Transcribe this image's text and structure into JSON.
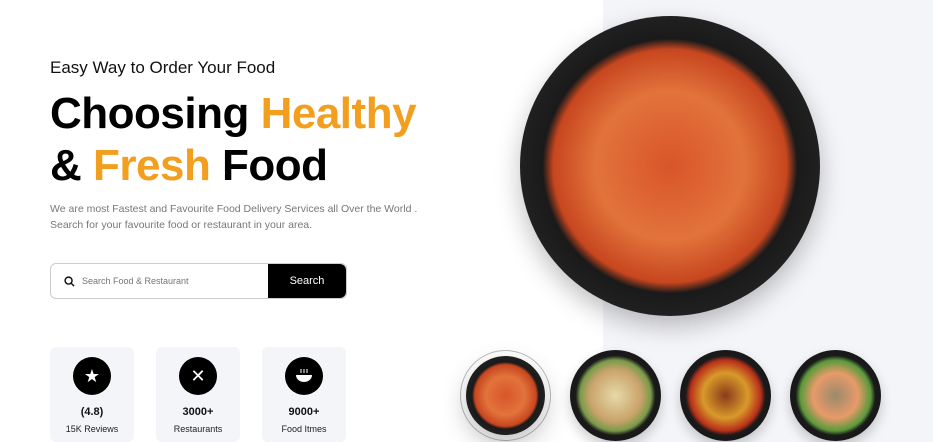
{
  "hero": {
    "eyebrow": "Easy Way to Order Your Food",
    "title_part1": "Choosing ",
    "title_accent1": "Healthy",
    "title_part2": "& ",
    "title_accent2": "Fresh",
    "title_part3": " Food",
    "description_line1": "We are most Fastest and Favourite Food Delivery Services all Over the World .",
    "description_line2": "Search for your favourite food or restaurant in your area."
  },
  "search": {
    "placeholder": "Search Food & Restaurant",
    "button_label": "Search"
  },
  "stats": [
    {
      "icon": "star-icon",
      "value": "(4.8)",
      "label": "15K Reviews"
    },
    {
      "icon": "fork-spoon-icon",
      "value": "3000+",
      "label": "Restaurants"
    },
    {
      "icon": "soup-bowl-icon",
      "value": "9000+",
      "label": "Food Itmes"
    }
  ],
  "colors": {
    "accent": "#f29f1f",
    "panel": "#f4f5f9"
  },
  "thumbnails": [
    "spaghetti",
    "pasta-salad",
    "stir-fry-noodles",
    "shrimp-soba"
  ],
  "selected_thumbnail": 0
}
